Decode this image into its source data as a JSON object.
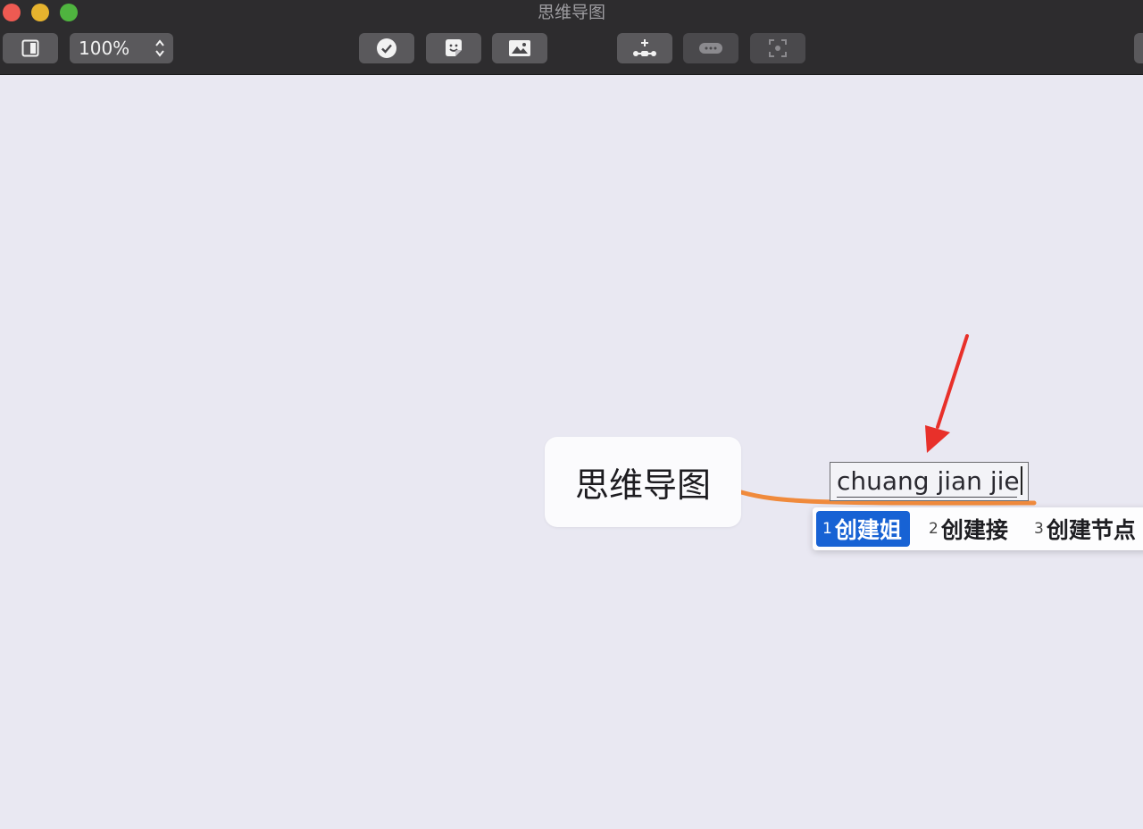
{
  "window": {
    "title": "思维导图"
  },
  "toolbar": {
    "zoom_value": "100%",
    "icons": {
      "sidebar": "sidebar-toggle-icon",
      "zoom_stepper": "chevron-up-down-icon",
      "task": "checkmark-circle-icon",
      "sticker": "sticker-face-icon",
      "image": "image-icon",
      "subtopic": "add-subtopic-icon",
      "relationship": "relationship-icon",
      "focus": "focus-icon"
    }
  },
  "canvas": {
    "central_topic": "思维导图",
    "editing_text": "chuang jian jie"
  },
  "ime": {
    "candidates": [
      {
        "index": "1",
        "text": "创建姐",
        "selected": true
      },
      {
        "index": "2",
        "text": "创建接",
        "selected": false
      },
      {
        "index": "3",
        "text": "创建节点",
        "selected": false
      }
    ]
  },
  "colors": {
    "toolbar_bg": "#2d2c2e",
    "canvas_bg": "#e9e8f2",
    "connector": "#f08a3c",
    "selection": "#1762d4",
    "arrow": "#e8302a"
  }
}
